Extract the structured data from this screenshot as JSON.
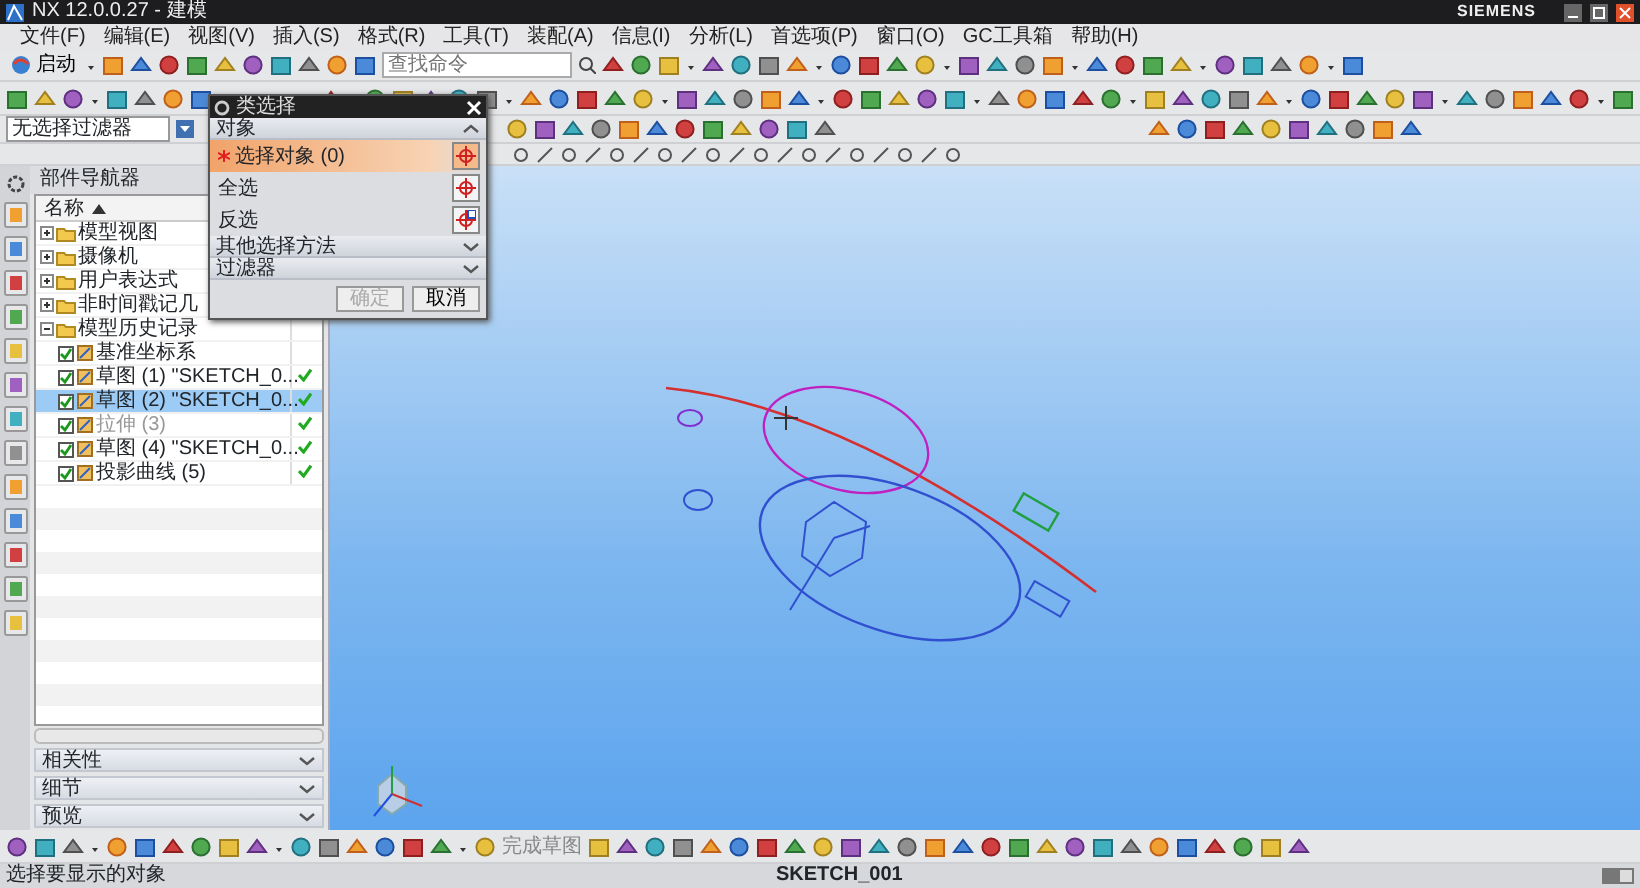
{
  "window": {
    "title": "NX 12.0.0.27 - 建模",
    "brand": "SIEMENS"
  },
  "menu": [
    "文件(F)",
    "编辑(E)",
    "视图(V)",
    "插入(S)",
    "格式(R)",
    "工具(T)",
    "装配(A)",
    "信息(I)",
    "分析(L)",
    "首选项(P)",
    "窗口(O)",
    "GC工具箱",
    "帮助(H)"
  ],
  "toolbar": {
    "start_label": "启动",
    "search": {
      "placeholder": "查找命令"
    }
  },
  "selection_filter": {
    "value": "无选择过滤器"
  },
  "navigator": {
    "title": "部件导航器",
    "column": "名称",
    "tree": [
      {
        "label": "模型视图",
        "expanded": false,
        "selected": false
      },
      {
        "label": "摄像机",
        "expanded": false,
        "selected": false
      },
      {
        "label": "用户表达式",
        "expanded": false,
        "selected": false
      },
      {
        "label": "非时间戳记几",
        "expanded": false,
        "selected": false
      },
      {
        "label": "模型历史记录",
        "expanded": true,
        "selected": false,
        "children": [
          {
            "label": "基准坐标系",
            "checked": true,
            "selected": false,
            "disabled": false,
            "ok": false
          },
          {
            "label": "草图 (1) \"SKETCH_0...",
            "checked": true,
            "selected": false,
            "disabled": false,
            "ok": true
          },
          {
            "label": "草图 (2) \"SKETCH_0...",
            "checked": true,
            "selected": true,
            "disabled": false,
            "ok": true
          },
          {
            "label": "拉伸 (3)",
            "checked": true,
            "selected": false,
            "disabled": true,
            "ok": true
          },
          {
            "label": "草图 (4) \"SKETCH_0...",
            "checked": true,
            "selected": false,
            "disabled": false,
            "ok": true
          },
          {
            "label": "投影曲线 (5)",
            "checked": true,
            "selected": false,
            "disabled": false,
            "ok": true
          }
        ]
      }
    ],
    "panels": [
      {
        "label": "相关性",
        "expanded": false
      },
      {
        "label": "细节",
        "expanded": false
      },
      {
        "label": "预览",
        "expanded": false
      }
    ]
  },
  "dialog": {
    "title": "类选择",
    "section": {
      "label": "对象",
      "expanded": true
    },
    "rows": [
      {
        "kind": "select",
        "label": "选择对象 (0)",
        "active": true
      },
      {
        "kind": "action",
        "label": "全选",
        "active": false
      },
      {
        "kind": "action",
        "label": "反选",
        "active": false
      }
    ],
    "groups": [
      {
        "label": "其他选择方法",
        "expanded": false
      },
      {
        "label": "过滤器",
        "expanded": false
      }
    ],
    "buttons": [
      {
        "label": "确定",
        "disabled": true
      },
      {
        "label": "取消",
        "disabled": false
      }
    ]
  },
  "bottom_toolbar": {
    "finish_sketch": {
      "label": "完成草图",
      "disabled": true
    }
  },
  "status_bar": {
    "message": "选择要显示的对象",
    "sketch": "SKETCH_001"
  }
}
